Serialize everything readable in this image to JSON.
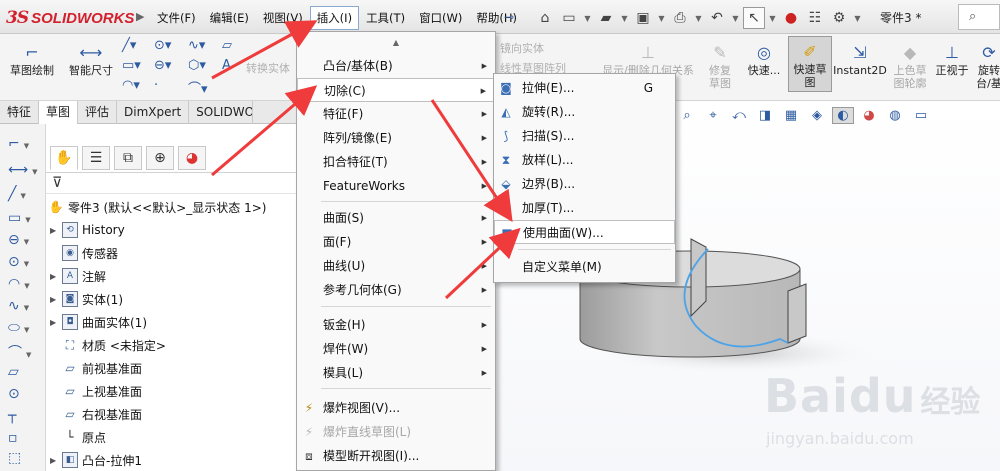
{
  "app": {
    "logo_prefix": "3S",
    "logo_name": "SOLIDWORKS",
    "document_title": "零件3 *",
    "collapse_arrow": "▶"
  },
  "menubar": {
    "items": [
      "文件(F)",
      "编辑(E)",
      "视图(V)",
      "插入(I)",
      "工具(T)",
      "窗口(W)",
      "帮助(H)"
    ],
    "active": "插入(I)"
  },
  "ribbon": {
    "sketch": "草图绘制",
    "smart_dim": "智能尺寸",
    "convert_entities": "转换实体",
    "mirror_entities": "镜向实体",
    "linear_pattern": "线性草图阵列",
    "display_delete_relations": "显示/删除几何关系",
    "repair_sketch": "修复草图",
    "quick_snaps": "快速...",
    "rapid_sketch": "快速草图",
    "instant2d": "Instant2D",
    "shaded_contours": "上色草图轮廓",
    "normal_to": "正视于",
    "rotate": "旋转",
    "rotate_sub": "台/基"
  },
  "tabs": [
    "特征",
    "草图",
    "评估",
    "DimXpert",
    "SOLIDWORKS"
  ],
  "active_tab": "草图",
  "feature_tree": {
    "root": "零件3  (默认<<默认>_显示状态 1>)",
    "items": [
      "History",
      "传感器",
      "注解",
      "实体(1)",
      "曲面实体(1)",
      "材质 <未指定>",
      "前视基准面",
      "上视基准面",
      "右视基准面",
      "原点",
      "凸台-拉伸1"
    ]
  },
  "insert_menu": {
    "scroll_indicator": "▲",
    "items": [
      "凸台/基体(B)",
      "切除(C)",
      "特征(F)",
      "阵列/镜像(E)",
      "扣合特征(T)",
      "FeatureWorks",
      "曲面(S)",
      "面(F)",
      "曲线(U)",
      "参考几何体(G)",
      "钣金(H)",
      "焊件(W)",
      "模具(L)",
      "爆炸视图(V)...",
      "爆炸直线草图(L)",
      "模型断开视图(I)..."
    ],
    "highlighted": "切除(C)"
  },
  "cut_menu": {
    "items": [
      "拉伸(E)...",
      "旋转(R)...",
      "扫描(S)...",
      "放样(L)...",
      "边界(B)...",
      "加厚(T)...",
      "使用曲面(W)...",
      "自定义菜单(M)"
    ],
    "accelerator_first": "G",
    "highlighted": "使用曲面(W)..."
  },
  "watermark": {
    "brand": "Bai",
    "paw": "du",
    "cn": "经验",
    "url": "jingyan.baidu.com"
  },
  "colors": {
    "arrow": "#ef3b3b",
    "menu_highlight_border": "#8aa9cf",
    "model_gray": "#c3c3c3",
    "surface_blue": "#4da3e8",
    "logo_red": "#d3202d"
  },
  "icons": {
    "pin": "📌",
    "search": "🔍",
    "filter": "▼"
  }
}
